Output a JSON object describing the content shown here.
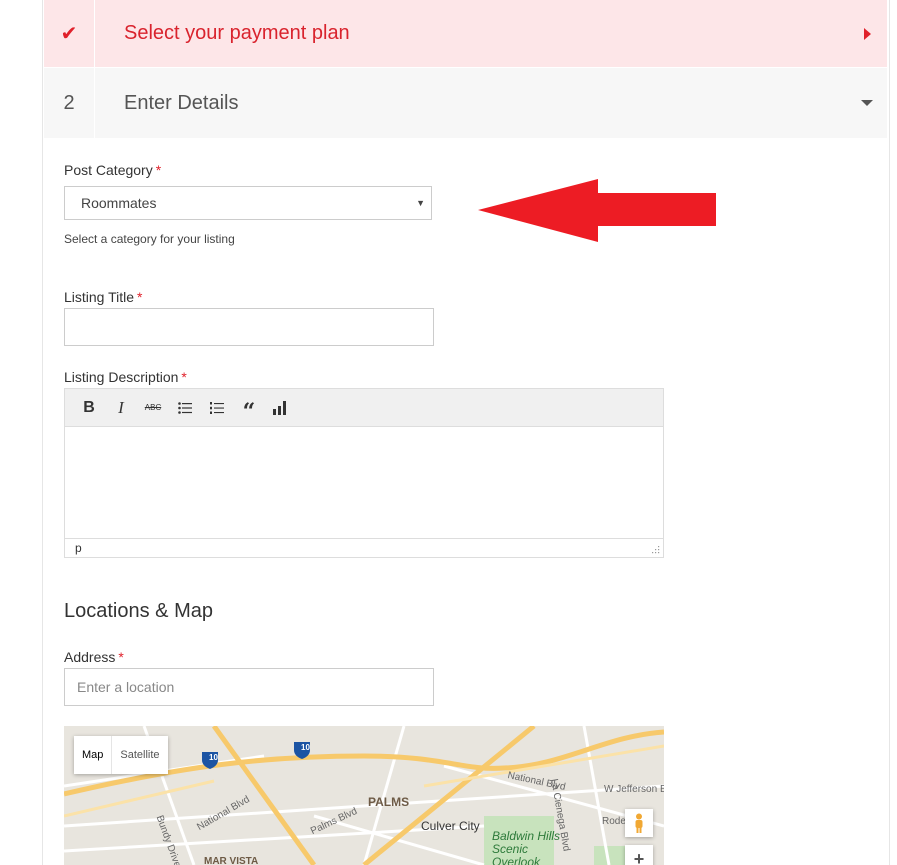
{
  "steps": [
    {
      "marker": "✔",
      "title": "Select your payment plan"
    },
    {
      "marker": "2",
      "title": "Enter Details"
    }
  ],
  "post_category": {
    "label": "Post Category",
    "required_mark": "*",
    "selected": "Roommates",
    "hint": "Select a category for your listing"
  },
  "listing_title": {
    "label": "Listing Title",
    "required_mark": "*",
    "value": ""
  },
  "listing_description": {
    "label": "Listing Description",
    "required_mark": "*",
    "toolbar": [
      "bold-icon",
      "italic-icon",
      "strikethrough-icon",
      "bullet-list-icon",
      "numbered-list-icon",
      "blockquote-icon",
      "chart-icon"
    ],
    "status_path": "p"
  },
  "locations": {
    "heading": "Locations & Map",
    "address_label": "Address",
    "required_mark": "*",
    "address_placeholder": "Enter a location"
  },
  "map": {
    "map_label": "Map",
    "satellite_label": "Satellite",
    "highway_shield": "10",
    "labels": {
      "national_blvd_left": "National Blvd",
      "national_blvd_right": "National Blvd",
      "palms_blvd": "Palms Blvd",
      "palms": "PALMS",
      "culver_city": "Culver City",
      "baldwin_hills": "Baldwin Hills Scenic Overlook",
      "w_jefferson": "W Jefferson B",
      "la_cienega": "La Cienega Blvd",
      "rodeo": "Rode",
      "bundy": "Bundy Drive",
      "mar_vista": "MAR VISTA"
    },
    "zoom_in": "+"
  },
  "colors": {
    "accent": "#e0212b",
    "step_active_bg": "#fde6e8",
    "arrow": "#ed1c24"
  }
}
